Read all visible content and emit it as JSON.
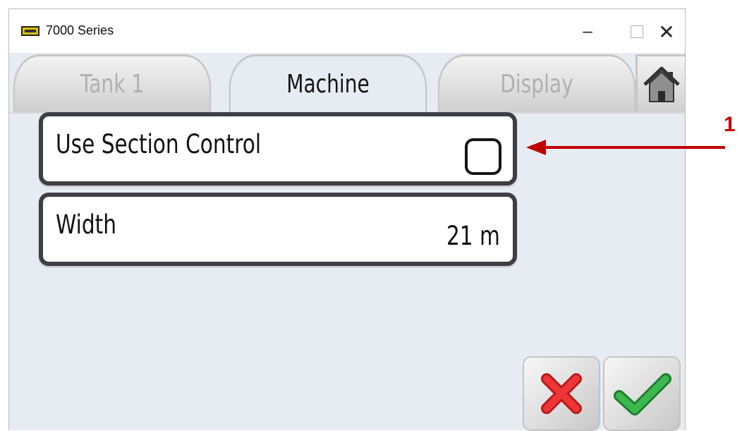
{
  "window": {
    "title": "7000 Series",
    "controls": {
      "minimize": "–",
      "maximize": "",
      "close": "✕"
    }
  },
  "tabs": [
    {
      "label": "Tank 1",
      "active": false
    },
    {
      "label": "Machine",
      "active": true
    },
    {
      "label": "Display",
      "active": false
    }
  ],
  "home_icon": "home-icon",
  "settings": {
    "use_section_control": {
      "label": "Use Section Control",
      "checked": false
    },
    "width": {
      "label": "Width",
      "value": "21 m"
    }
  },
  "actions": {
    "cancel_icon": "red-x-icon",
    "ok_icon": "green-check-icon"
  },
  "callout": {
    "number": "1"
  },
  "colors": {
    "callout": "#c00000",
    "accept": "#2ea043",
    "reject": "#e02424"
  }
}
